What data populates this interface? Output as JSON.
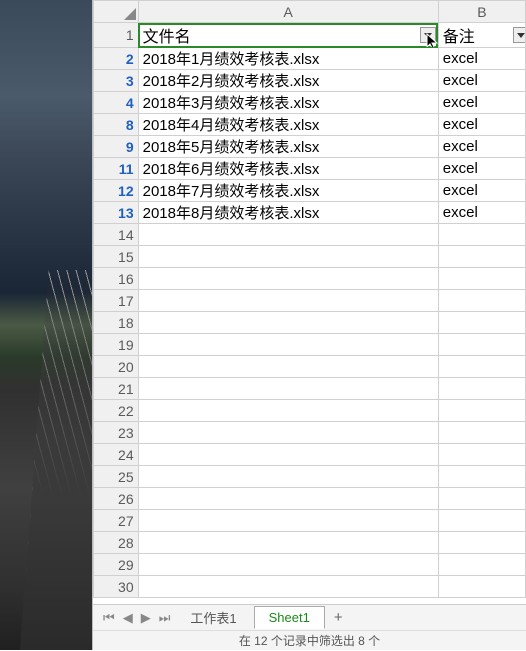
{
  "columns": {
    "a": "A",
    "b": "B"
  },
  "header_row_num": "1",
  "headers": {
    "filename": "文件名",
    "remark": "备注"
  },
  "filtered_rows": [
    {
      "num": "2",
      "filename": "2018年1月绩效考核表.xlsx",
      "remark": "excel"
    },
    {
      "num": "3",
      "filename": "2018年2月绩效考核表.xlsx",
      "remark": "excel"
    },
    {
      "num": "4",
      "filename": "2018年3月绩效考核表.xlsx",
      "remark": "excel"
    },
    {
      "num": "8",
      "filename": "2018年4月绩效考核表.xlsx",
      "remark": "excel"
    },
    {
      "num": "9",
      "filename": "2018年5月绩效考核表.xlsx",
      "remark": "excel"
    },
    {
      "num": "11",
      "filename": "2018年6月绩效考核表.xlsx",
      "remark": "excel"
    },
    {
      "num": "12",
      "filename": "2018年7月绩效考核表.xlsx",
      "remark": "excel"
    },
    {
      "num": "13",
      "filename": "2018年8月绩效考核表.xlsx",
      "remark": "excel"
    }
  ],
  "empty_row_nums": [
    "14",
    "15",
    "16",
    "17",
    "18",
    "19",
    "20",
    "21",
    "22",
    "23",
    "24",
    "25",
    "26",
    "27",
    "28",
    "29",
    "30"
  ],
  "tabs": {
    "tab1": "工作表1",
    "tab2": "Sheet1"
  },
  "add_tab": "+",
  "status": "在 12 个记录中筛选出 8 个"
}
